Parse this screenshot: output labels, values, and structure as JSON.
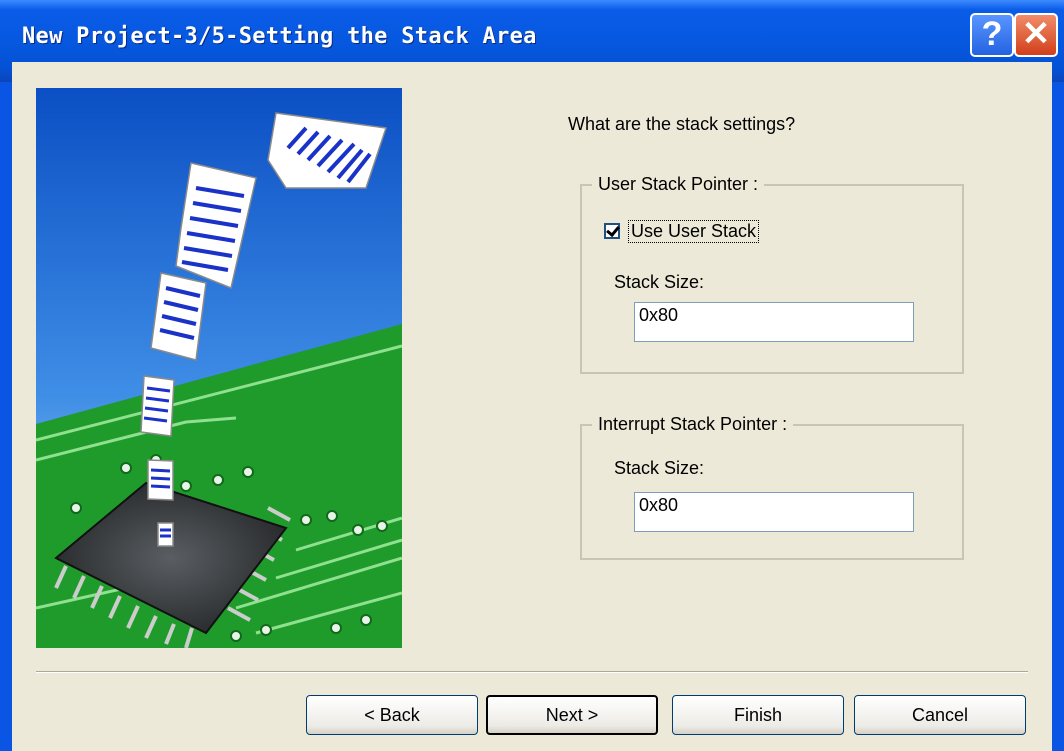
{
  "window": {
    "title": "New Project-3/5-Setting the Stack Area",
    "help_label": "?",
    "close_label": "✕"
  },
  "question": "What are the stack settings?",
  "user_stack": {
    "group_label": "User Stack Pointer :",
    "checkbox_label": "Use User Stack",
    "checkbox_checked": true,
    "size_label": "Stack Size:",
    "size_value": "0x80"
  },
  "interrupt_stack": {
    "group_label": "Interrupt Stack Pointer :",
    "size_label": "Stack Size:",
    "size_value": "0x80"
  },
  "buttons": {
    "back": "< Back",
    "next": "Next >",
    "finish": "Finish",
    "cancel": "Cancel"
  }
}
